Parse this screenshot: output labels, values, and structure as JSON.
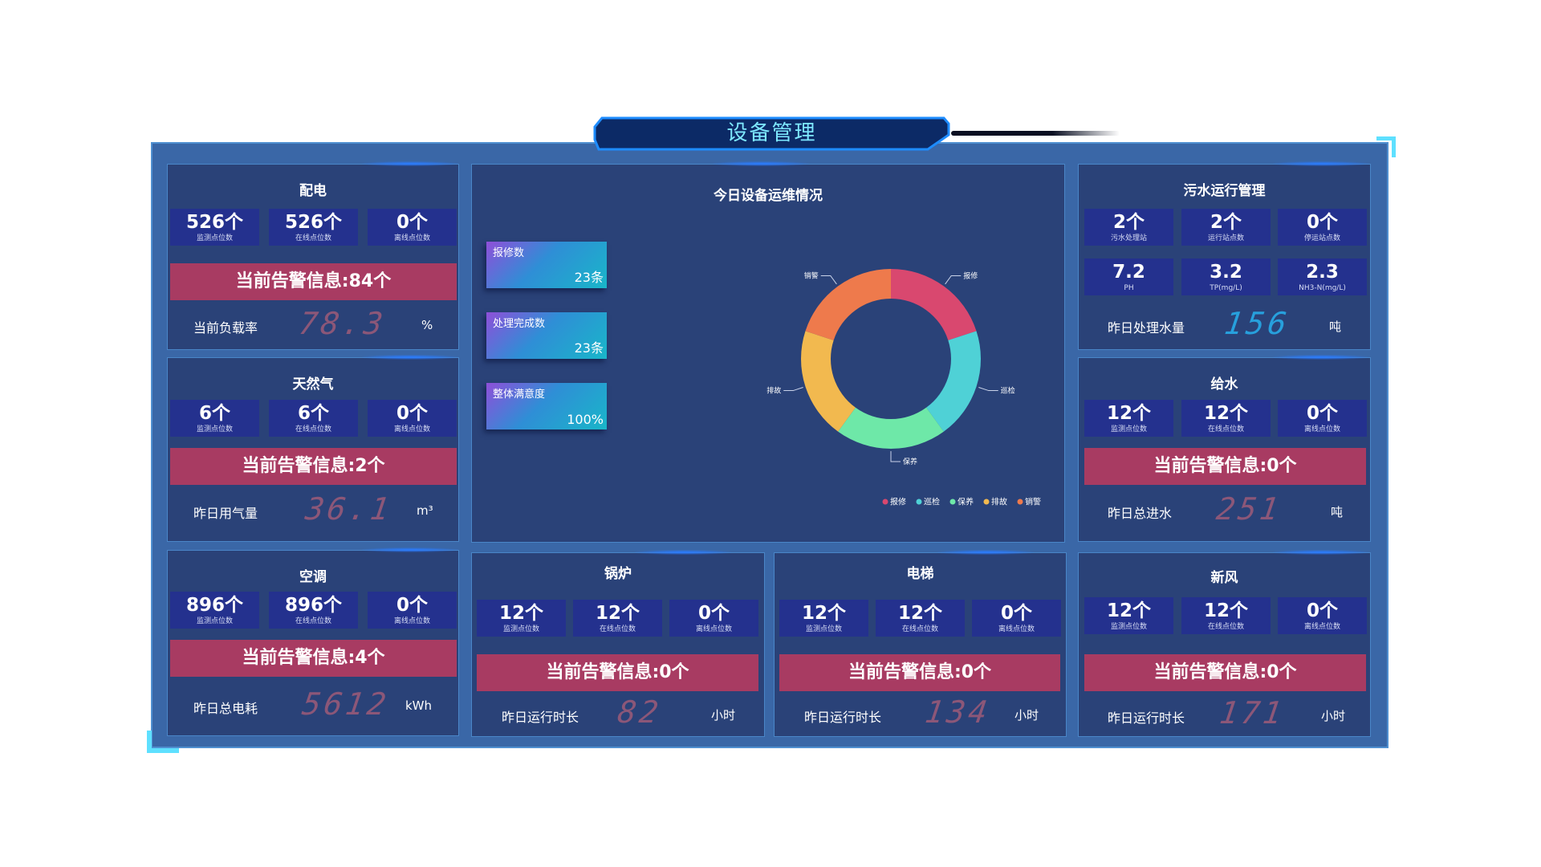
{
  "title": "设备管理",
  "colors": {
    "bg": "#3a67a7",
    "panel": "#2a4278",
    "stat": "#24318e",
    "alert": "#a83b62",
    "meter": "#8c5778",
    "meter_cyan": "#27a0dd"
  },
  "panels": {
    "power": {
      "title": "配电",
      "stats": [
        {
          "value": "526个",
          "label": "监测点位数"
        },
        {
          "value": "526个",
          "label": "在线点位数"
        },
        {
          "value": "0个",
          "label": "离线点位数"
        }
      ],
      "alert": "当前告警信息:84个",
      "metric": {
        "label": "当前负载率",
        "value": "78.3",
        "unit": "%"
      }
    },
    "gas": {
      "title": "天然气",
      "stats": [
        {
          "value": "6个",
          "label": "监测点位数"
        },
        {
          "value": "6个",
          "label": "在线点位数"
        },
        {
          "value": "0个",
          "label": "离线点位数"
        }
      ],
      "alert": "当前告警信息:2个",
      "metric": {
        "label": "昨日用气量",
        "value": "36.1",
        "unit": "m³"
      }
    },
    "ac": {
      "title": "空调",
      "stats": [
        {
          "value": "896个",
          "label": "监测点位数"
        },
        {
          "value": "896个",
          "label": "在线点位数"
        },
        {
          "value": "0个",
          "label": "离线点位数"
        }
      ],
      "alert": "当前告警信息:4个",
      "metric": {
        "label": "昨日总电耗",
        "value": "5612",
        "unit": "kWh"
      }
    },
    "boiler": {
      "title": "锅炉",
      "stats": [
        {
          "value": "12个",
          "label": "监测点位数"
        },
        {
          "value": "12个",
          "label": "在线点位数"
        },
        {
          "value": "0个",
          "label": "离线点位数"
        }
      ],
      "alert": "当前告警信息:0个",
      "metric": {
        "label": "昨日运行时长",
        "value": "82",
        "unit": "小时"
      }
    },
    "elevator": {
      "title": "电梯",
      "stats": [
        {
          "value": "12个",
          "label": "监测点位数"
        },
        {
          "value": "12个",
          "label": "在线点位数"
        },
        {
          "value": "0个",
          "label": "离线点位数"
        }
      ],
      "alert": "当前告警信息:0个",
      "metric": {
        "label": "昨日运行时长",
        "value": "134",
        "unit": "小时"
      }
    },
    "sewage": {
      "title": "污水运行管理",
      "stats": [
        {
          "value": "2个",
          "label": "污水处理站"
        },
        {
          "value": "2个",
          "label": "运行站点数"
        },
        {
          "value": "0个",
          "label": "停运站点数"
        }
      ],
      "stats2": [
        {
          "value": "7.2",
          "label": "PH"
        },
        {
          "value": "3.2",
          "label": "TP(mg/L)"
        },
        {
          "value": "2.3",
          "label": "NH3-N(mg/L)"
        }
      ],
      "metric": {
        "label": "昨日处理水量",
        "value": "156",
        "unit": "吨"
      }
    },
    "water": {
      "title": "给水",
      "stats": [
        {
          "value": "12个",
          "label": "监测点位数"
        },
        {
          "value": "12个",
          "label": "在线点位数"
        },
        {
          "value": "0个",
          "label": "离线点位数"
        }
      ],
      "alert": "当前告警信息:0个",
      "metric": {
        "label": "昨日总进水",
        "value": "251",
        "unit": "吨"
      }
    },
    "fresh_air": {
      "title": "新风",
      "stats": [
        {
          "value": "12个",
          "label": "监测点位数"
        },
        {
          "value": "12个",
          "label": "在线点位数"
        },
        {
          "value": "0个",
          "label": "离线点位数"
        }
      ],
      "alert": "当前告警信息:0个",
      "metric": {
        "label": "昨日运行时长",
        "value": "171",
        "unit": "小时"
      }
    }
  },
  "center": {
    "title": "今日设备运维情况",
    "kpis": [
      {
        "label": "报修数",
        "value": "23条"
      },
      {
        "label": "处理完成数",
        "value": "23条"
      },
      {
        "label": "整体满意度",
        "value": "100%"
      }
    ]
  },
  "chart_data": {
    "type": "pie",
    "donut": true,
    "categories": [
      "报修",
      "巡检",
      "保养",
      "排故",
      "销警"
    ],
    "values": [
      20,
      20,
      20,
      20,
      20
    ],
    "colors": [
      "#d9486f",
      "#4fd1d6",
      "#6ee8a8",
      "#f2b94f",
      "#ee7a4c"
    ],
    "legend_position": "bottom-right"
  }
}
